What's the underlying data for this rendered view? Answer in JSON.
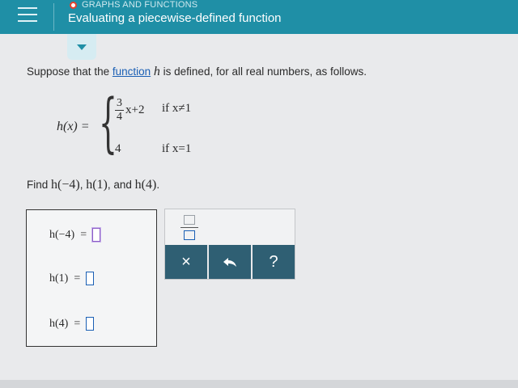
{
  "header": {
    "category": "GRAPHS AND FUNCTIONS",
    "title": "Evaluating a piecewise-defined function"
  },
  "problem": {
    "intro_before": "Suppose that the ",
    "link": "function",
    "intro_var": "h",
    "intro_after": " is defined, for all real numbers, as follows."
  },
  "piecewise": {
    "lhs": "h(x) =",
    "case1_num": "3",
    "case1_den": "4",
    "case1_expr": "x+2",
    "case1_cond": "if x≠1",
    "case2_value": "4",
    "case2_cond": "if x=1"
  },
  "find": {
    "prefix": "Find ",
    "items": [
      "h(−4)",
      "h(1)",
      "h(4)"
    ],
    "sep": ", ",
    "and": ", and ",
    "end": "."
  },
  "answers": [
    {
      "label": "h(−4)",
      "eq": "="
    },
    {
      "label": "h(1)",
      "eq": "="
    },
    {
      "label": "h(4)",
      "eq": "="
    }
  ],
  "keypad": {
    "clear_label": "×",
    "help_label": "?",
    "icons": [
      "fraction-icon",
      "undo-icon"
    ]
  },
  "colors": {
    "header": "#1f8fa6",
    "keypad_dark": "#2f5f73",
    "link": "#1a5fb4"
  }
}
